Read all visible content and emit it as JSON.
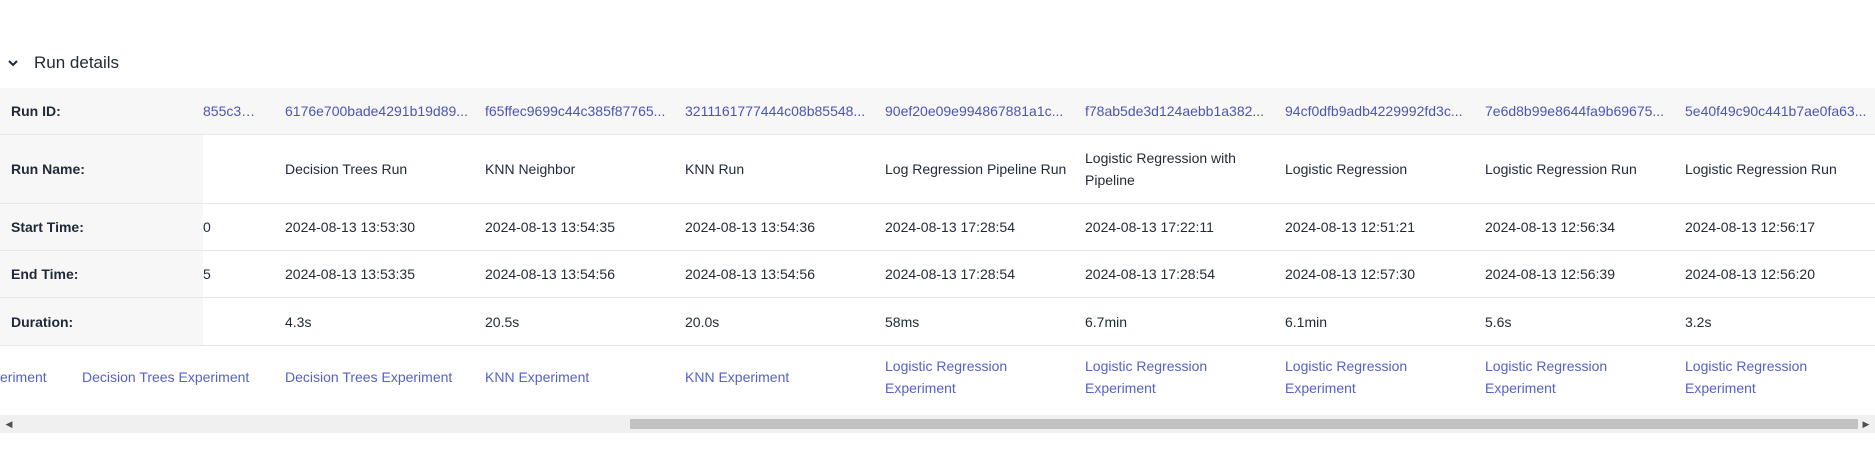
{
  "section": {
    "title": "Run details",
    "expanded": true
  },
  "labels": {
    "run_id": "Run ID:",
    "run_name": "Run Name:",
    "start_time": "Start Time:",
    "end_time": "End Time:",
    "duration": "Duration:"
  },
  "partial_column": {
    "run_id": "855c3a...",
    "start_time": "0",
    "end_time": "5",
    "experiment": "eriment"
  },
  "runs": [
    {
      "run_id": "6176e700bade4291b19d89...",
      "run_name": "Decision Trees Run",
      "start_time": "2024-08-13 13:53:30",
      "end_time": "2024-08-13 13:53:35",
      "duration": "4.3s",
      "experiment": "Decision Trees Experiment"
    },
    {
      "run_id": "f65ffec9699c44c385f87765...",
      "run_name": "KNN Neighbor",
      "start_time": "2024-08-13 13:54:35",
      "end_time": "2024-08-13 13:54:56",
      "duration": "20.5s",
      "experiment": "KNN Experiment"
    },
    {
      "run_id": "3211161777444c08b85548...",
      "run_name": "KNN Run",
      "start_time": "2024-08-13 13:54:36",
      "end_time": "2024-08-13 13:54:56",
      "duration": "20.0s",
      "experiment": "KNN Experiment"
    },
    {
      "run_id": "90ef20e09e994867881a1c...",
      "run_name": "Log Regression Pipeline Run",
      "start_time": "2024-08-13 17:28:54",
      "end_time": "2024-08-13 17:28:54",
      "duration": "58ms",
      "experiment": "Logistic Regression Experiment"
    },
    {
      "run_id": "f78ab5de3d124aebb1a382...",
      "run_name": "Logistic Regression with Pipeline",
      "start_time": "2024-08-13 17:22:11",
      "end_time": "2024-08-13 17:28:54",
      "duration": "6.7min",
      "experiment": "Logistic Regression Experiment"
    },
    {
      "run_id": "94cf0dfb9adb4229992fd3c...",
      "run_name": "Logistic Regression",
      "start_time": "2024-08-13 12:51:21",
      "end_time": "2024-08-13 12:57:30",
      "duration": "6.1min",
      "experiment": "Logistic Regression Experiment"
    },
    {
      "run_id": "7e6d8b99e8644fa9b69675...",
      "run_name": "Logistic Regression Run",
      "start_time": "2024-08-13 12:56:34",
      "end_time": "2024-08-13 12:56:39",
      "duration": "5.6s",
      "experiment": "Logistic Regression Experiment"
    },
    {
      "run_id": "5e40f49c90c441b7ae0fa63...",
      "run_name": "Logistic Regression Run",
      "start_time": "2024-08-13 12:56:17",
      "end_time": "2024-08-13 12:56:20",
      "duration": "3.2s",
      "experiment": "Logistic Regression Experiment"
    }
  ],
  "extra_experiment_col": "Decision Trees Experiment",
  "scrollbar": {
    "position_fraction": 0.33
  },
  "colors": {
    "link": "#4b55b5",
    "label_bg": "#f7f7f7",
    "border": "#e6e6e6"
  }
}
